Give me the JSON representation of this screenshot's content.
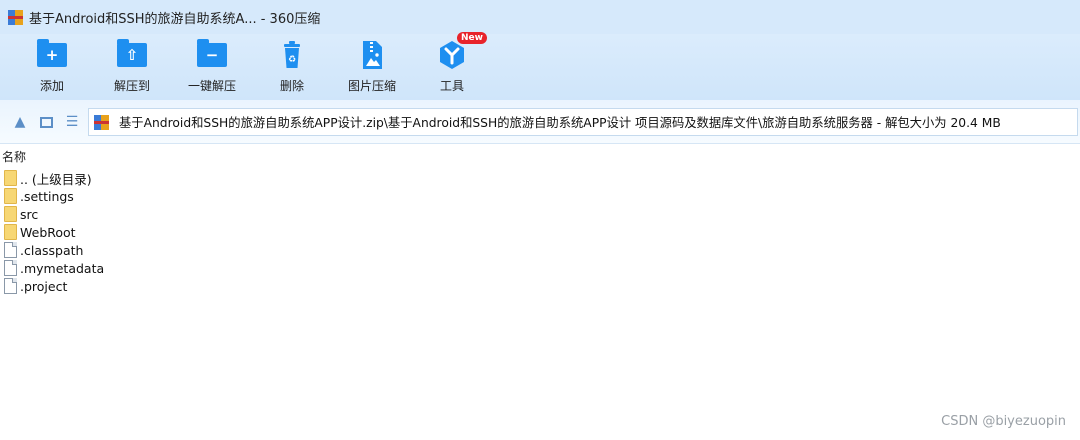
{
  "window": {
    "title": "基于Android和SSH的旅游自助系统A... - 360压缩"
  },
  "toolbar": {
    "items": [
      {
        "label": "添加",
        "icon": "add-icon"
      },
      {
        "label": "解压到",
        "icon": "extract-to-icon"
      },
      {
        "label": "一键解压",
        "icon": "one-click-extract-icon"
      },
      {
        "label": "删除",
        "icon": "delete-icon"
      },
      {
        "label": "图片压缩",
        "icon": "image-compress-icon"
      },
      {
        "label": "工具",
        "icon": "tools-icon",
        "badge": "New"
      }
    ]
  },
  "address": {
    "path": "基于Android和SSH的旅游自助系统APP设计.zip\\基于Android和SSH的旅游自助系统APP设计 项目源码及数据库文件\\旅游自助系统服务器 - 解包大小为 20.4 MB"
  },
  "list": {
    "column_name": "名称",
    "items": [
      {
        "name": ".. (上级目录)",
        "type": "folder"
      },
      {
        "name": ".settings",
        "type": "folder"
      },
      {
        "name": "src",
        "type": "folder"
      },
      {
        "name": "WebRoot",
        "type": "folder"
      },
      {
        "name": ".classpath",
        "type": "file"
      },
      {
        "name": ".mymetadata",
        "type": "file"
      },
      {
        "name": ".project",
        "type": "file"
      }
    ]
  },
  "watermark": "CSDN @biyezuopin",
  "colors": {
    "accent": "#1e8ff0",
    "toolbar_bg": "#d6e9fb",
    "badge": "#e8232b"
  }
}
